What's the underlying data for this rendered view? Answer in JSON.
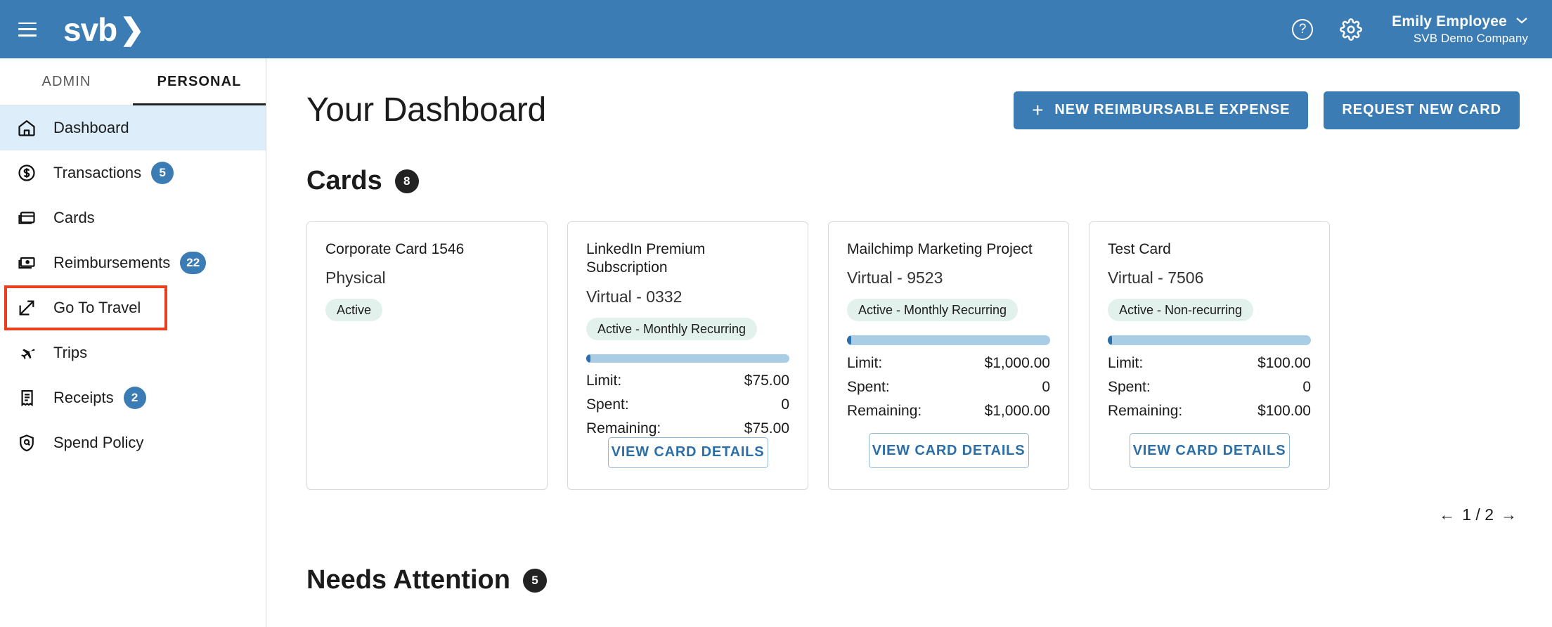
{
  "topbar": {
    "menu_icon": "hamburger-icon",
    "logo_text": "svb",
    "logo_chevron": "❯",
    "help_icon": "?",
    "settings_icon": "gear-icon",
    "user_name": "Emily Employee",
    "user_company": "SVB Demo Company",
    "user_caret": "⌄",
    "bg_color": "#3C7CB4"
  },
  "sidebar": {
    "tabs": [
      {
        "label": "ADMIN",
        "active": false
      },
      {
        "label": "PERSONAL",
        "active": true
      }
    ],
    "items": [
      {
        "label": "Dashboard",
        "icon": "home-icon",
        "badge": "",
        "active": true,
        "highlighted": false
      },
      {
        "label": "Transactions",
        "icon": "dollar-circle-icon",
        "badge": "5",
        "active": false,
        "highlighted": false
      },
      {
        "label": "Cards",
        "icon": "credit-card-icon",
        "badge": "",
        "active": false,
        "highlighted": false
      },
      {
        "label": "Reimbursements",
        "icon": "money-bill-icon",
        "badge": "22",
        "active": false,
        "highlighted": false
      },
      {
        "label": "Go To Travel",
        "icon": "external-link-icon",
        "badge": "",
        "active": false,
        "highlighted": true
      },
      {
        "label": "Trips",
        "icon": "airplane-icon",
        "badge": "",
        "active": false,
        "highlighted": false
      },
      {
        "label": "Receipts",
        "icon": "receipt-icon",
        "badge": "2",
        "active": false,
        "highlighted": false
      },
      {
        "label": "Spend Policy",
        "icon": "shield-icon",
        "badge": "",
        "active": false,
        "highlighted": false
      }
    ],
    "highlight_color": "#E8401F",
    "active_bg_color": "#DDEDF9",
    "badge_color": "#3C7CB4"
  },
  "main": {
    "page_title": "Your Dashboard",
    "new_expense_button": "NEW REIMBURSABLE EXPENSE",
    "new_expense_plus": "+",
    "request_card_button": "REQUEST NEW CARD",
    "cards_section": {
      "title": "Cards",
      "count": "8",
      "labels": {
        "limit": "Limit:",
        "spent": "Spent:",
        "remaining": "Remaining:"
      },
      "view_details_button": "VIEW CARD DETAILS",
      "items": [
        {
          "title": "Corporate Card 1546",
          "subtitle": "Physical",
          "status": "Active",
          "has_limits": false,
          "limit": "",
          "spent": "",
          "remaining": "",
          "progress_percent": 0,
          "has_button": false
        },
        {
          "title": "LinkedIn Premium Subscription",
          "subtitle": "Virtual - 0332",
          "status": "Active - Monthly Recurring",
          "has_limits": true,
          "limit": "$75.00",
          "spent": "0",
          "remaining": "$75.00",
          "progress_percent": 2,
          "has_button": true
        },
        {
          "title": "Mailchimp Marketing Project",
          "subtitle": "Virtual - 9523",
          "status": "Active - Monthly Recurring",
          "has_limits": true,
          "limit": "$1,000.00",
          "spent": "0",
          "remaining": "$1,000.00",
          "progress_percent": 2,
          "has_button": true
        },
        {
          "title": "Test Card",
          "subtitle": "Virtual - 7506",
          "status": "Active - Non-recurring",
          "has_limits": true,
          "limit": "$100.00",
          "spent": "0",
          "remaining": "$100.00",
          "progress_percent": 2,
          "has_button": true
        }
      ],
      "pager": {
        "prev": "←",
        "page": "1 / 2",
        "next": "→"
      }
    },
    "attention_section": {
      "title": "Needs Attention",
      "count": "5"
    }
  }
}
